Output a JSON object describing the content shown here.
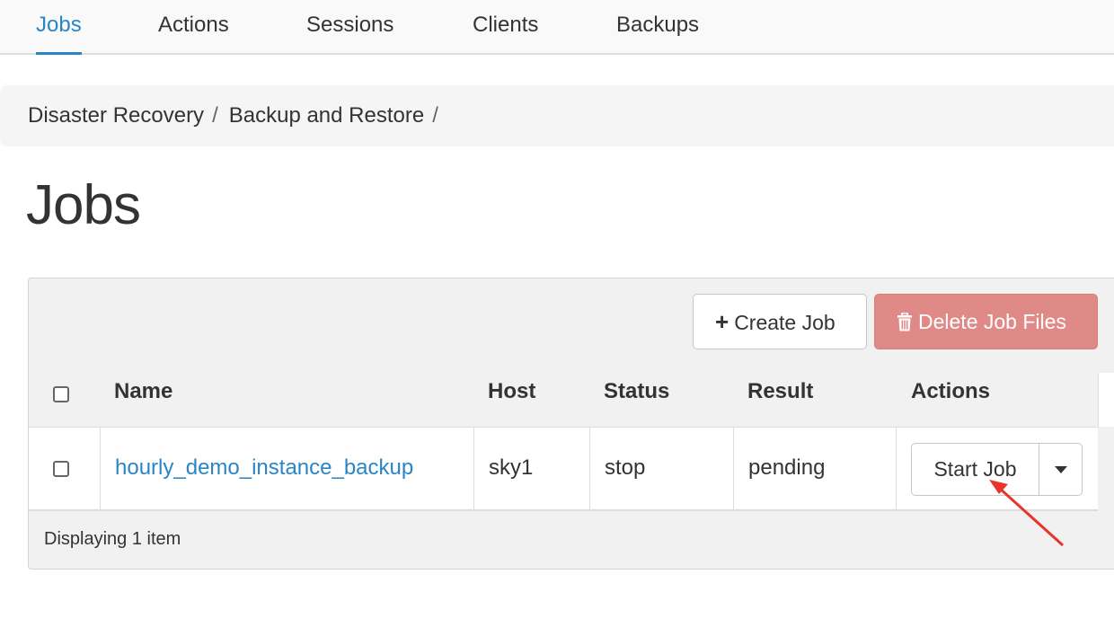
{
  "tabs": [
    {
      "label": "Jobs",
      "active": true
    },
    {
      "label": "Actions",
      "active": false
    },
    {
      "label": "Sessions",
      "active": false
    },
    {
      "label": "Clients",
      "active": false
    },
    {
      "label": "Backups",
      "active": false
    }
  ],
  "breadcrumb": {
    "items": [
      "Disaster Recovery",
      "Backup and Restore"
    ],
    "separator": "/"
  },
  "page": {
    "title": "Jobs"
  },
  "toolbar": {
    "create_label": "Create Job",
    "create_icon": "plus-icon",
    "delete_label": "Delete Job Files",
    "delete_icon": "trash-icon"
  },
  "table": {
    "columns": [
      "Name",
      "Host",
      "Status",
      "Result",
      "Actions"
    ],
    "rows": [
      {
        "name": "hourly_demo_instance_backup",
        "host": "sky1",
        "status": "stop",
        "result": "pending",
        "action_label": "Start Job",
        "action_toggle_icon": "caret-down-icon"
      }
    ],
    "footer": "Displaying 1 item"
  },
  "colors": {
    "accent": "#2a85c6",
    "danger": "#e08a87",
    "annotation": "#e8342a"
  }
}
